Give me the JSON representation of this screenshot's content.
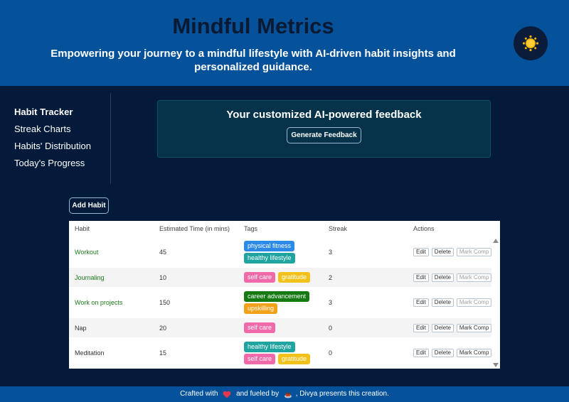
{
  "header": {
    "title": "Mindful Metrics",
    "tagline": "Empowering your journey to a mindful lifestyle with AI-driven habit insights and personalized guidance.",
    "theme_icon": "sun-icon"
  },
  "sidebar": {
    "items": [
      {
        "label": "Habit Tracker",
        "active": true
      },
      {
        "label": "Streak Charts",
        "active": false
      },
      {
        "label": "Habits' Distribution",
        "active": false
      },
      {
        "label": "Today's Progress",
        "active": false
      }
    ]
  },
  "feedback": {
    "title": "Your customized AI-powered feedback",
    "button_label": "Generate Feedback"
  },
  "actions": {
    "add_habit_label": "Add Habit"
  },
  "table": {
    "columns": [
      "Habit",
      "Estimated Time (in mins)",
      "Tags",
      "Streak",
      "Actions"
    ],
    "action_labels": {
      "edit": "Edit",
      "delete": "Delete",
      "mark": "Mark Comp"
    },
    "rows": [
      {
        "habit": "Workout",
        "time": "45",
        "tags": [
          {
            "label": "physical fitness",
            "color": "#2b8ae8"
          },
          {
            "label": "healthy lifestyle",
            "color": "#1fa4a0"
          }
        ],
        "streak": "3",
        "completed": true
      },
      {
        "habit": "Journaling",
        "time": "10",
        "tags": [
          {
            "label": "self care",
            "color": "#f06aaa"
          },
          {
            "label": "gratitude",
            "color": "#f2c21a"
          }
        ],
        "streak": "2",
        "completed": true
      },
      {
        "habit": "Work on projects",
        "time": "150",
        "tags": [
          {
            "label": "career advancement",
            "color": "#157a12"
          },
          {
            "label": "upskilling",
            "color": "#f2a21a"
          }
        ],
        "streak": "3",
        "completed": true
      },
      {
        "habit": "Nap",
        "time": "20",
        "tags": [
          {
            "label": "self care",
            "color": "#f06aaa"
          }
        ],
        "streak": "0",
        "completed": false
      },
      {
        "habit": "Meditation",
        "time": "15",
        "tags": [
          {
            "label": "healthy lifestyle",
            "color": "#1fa4a0"
          },
          {
            "label": "self care",
            "color": "#f06aaa"
          },
          {
            "label": "gratitude",
            "color": "#f2c21a"
          }
        ],
        "streak": "0",
        "completed": false
      }
    ]
  },
  "footer": {
    "part1": "Crafted with",
    "heart_icon": "heart-icon",
    "part2": "and fueled by",
    "coffee_icon": "coffee-icon",
    "part3": ", Divya presents this creation."
  },
  "colors": {
    "header_bg": "#05529a",
    "page_bg": "#031a3a",
    "card_bg": "#06334a",
    "habit_name": "#1a7a1a"
  }
}
